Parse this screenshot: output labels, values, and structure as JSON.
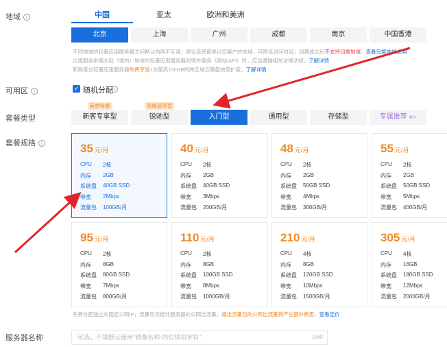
{
  "labels": {
    "region": "地域",
    "availability": "可用区",
    "package_type": "套餐类型",
    "package_spec": "套餐规格",
    "server_name": "服务器名称"
  },
  "region_tabs": [
    "中国",
    "亚太",
    "欧洲和美洲"
  ],
  "cities": [
    "北京",
    "上海",
    "广州",
    "成都",
    "南京",
    "中国香港"
  ],
  "notes": {
    "line1_a": "不同地域的轻量应用服务器之间默认内网不互通；建议选择最靠近您客户的地域，可降低访问时延；创建成功后",
    "line1_red": "不支持切换地域",
    "line1_b": "，",
    "line1_link": "查看完整地域说明",
    "line2_a": "出境服务中国大陆（境内）地域的轻量应用服务器对境外服务（网站/API）时，应当遵循相关法律法规。",
    "line2_link": "了解详情",
    "line3_a": "新购首台轻量应用服务器",
    "line3_orange": "免费享受",
    "line3_b": "1次最高100GB的跨区域云硬盘快照扩容。",
    "line3_link": "了解详情"
  },
  "availability": {
    "check": "✓",
    "label": "随机分配"
  },
  "package_types": [
    {
      "label": "新客专享型",
      "badge": "首单特惠"
    },
    {
      "label": "锐驰型",
      "badge": "高峰值带宽"
    },
    {
      "label": "入门型",
      "badge": ""
    },
    {
      "label": "通用型",
      "badge": ""
    },
    {
      "label": "存储型",
      "badge": ""
    },
    {
      "label": "专属推荐",
      "sup": "AI+",
      "badge": ""
    }
  ],
  "spec_keys": [
    "CPU",
    "内存",
    "系统盘",
    "带宽",
    "流量包"
  ],
  "price_unit": "元/月",
  "plans": [
    {
      "price": "35",
      "cpu": "2核",
      "mem": "2GB",
      "disk": "40GB SSD",
      "bw": "2Mbps",
      "traffic": "100GB/月"
    },
    {
      "price": "40",
      "cpu": "2核",
      "mem": "2GB",
      "disk": "40GB SSD",
      "bw": "3Mbps",
      "traffic": "200GB/月"
    },
    {
      "price": "48",
      "cpu": "2核",
      "mem": "2GB",
      "disk": "50GB SSD",
      "bw": "4Mbps",
      "traffic": "300GB/月"
    },
    {
      "price": "55",
      "cpu": "2核",
      "mem": "2GB",
      "disk": "50GB SSD",
      "bw": "5Mbps",
      "traffic": "400GB/月"
    },
    {
      "price": "95",
      "cpu": "2核",
      "mem": "8GB",
      "disk": "80GB SSD",
      "bw": "7Mbps",
      "traffic": "800GB/月"
    },
    {
      "price": "110",
      "cpu": "2核",
      "mem": "8GB",
      "disk": "100GB SSD",
      "bw": "8Mbps",
      "traffic": "1000GB/月"
    },
    {
      "price": "210",
      "cpu": "4核",
      "mem": "8GB",
      "disk": "120GB SSD",
      "bw": "10Mbps",
      "traffic": "1500GB/月"
    },
    {
      "price": "305",
      "cpu": "4核",
      "mem": "16GB",
      "disk": "180GB SSD",
      "bw": "12Mbps",
      "traffic": "2000GB/月"
    }
  ],
  "bottom_note": {
    "a": "免费分配独立的固定公网IP；流量包仅统计服务器的公网出流量，",
    "orange": "超出流量包的公网出流量将产生额外费用",
    "b": "，",
    "link": "查看定价"
  },
  "server_name": {
    "placeholder": "可选，不填默认使用\"镜像名称-四位随机字符\"",
    "count": "0/60"
  },
  "colors": {
    "accent": "#1a6fdc",
    "price": "#f08a24",
    "arrow": "#e0262b"
  }
}
